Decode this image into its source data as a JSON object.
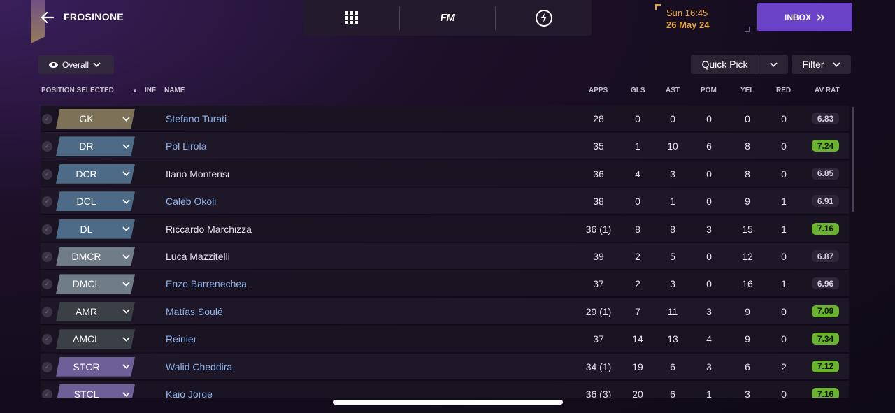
{
  "header": {
    "club_name": "FROSINONE",
    "time": "Sun 16:45",
    "date": "26 May 24",
    "inbox_label": "INBOX",
    "fm_label": "FM"
  },
  "toolbar": {
    "view_label": "Overall",
    "quick_pick_label": "Quick Pick",
    "filter_label": "Filter"
  },
  "columns": {
    "position": "POSITION SELECTED",
    "inf": "INF",
    "name": "NAME",
    "apps": "APPS",
    "gls": "GLS",
    "ast": "AST",
    "pom": "POM",
    "yel": "YEL",
    "red": "RED",
    "av_rat": "AV RAT"
  },
  "colors": {
    "gk": "#7d7257",
    "def": "#4d6b86",
    "dm": "#717c89",
    "am": "#3a4046",
    "st": "#6d5f97",
    "rating_good": "#6ab32e",
    "inbox": "#6b43c9"
  },
  "rows": [
    {
      "pos": "GK",
      "group": "gk",
      "name": "Stefano Turati",
      "link": true,
      "apps": "28",
      "gls": "0",
      "ast": "0",
      "pom": "0",
      "yel": "0",
      "red": "0",
      "rat": "6.83",
      "good": false
    },
    {
      "pos": "DR",
      "group": "def",
      "name": "Pol Lirola",
      "link": true,
      "apps": "35",
      "gls": "1",
      "ast": "10",
      "pom": "6",
      "yel": "8",
      "red": "0",
      "rat": "7.24",
      "good": true
    },
    {
      "pos": "DCR",
      "group": "def",
      "name": "Ilario Monterisi",
      "link": false,
      "apps": "36",
      "gls": "4",
      "ast": "3",
      "pom": "0",
      "yel": "8",
      "red": "0",
      "rat": "6.85",
      "good": false
    },
    {
      "pos": "DCL",
      "group": "def",
      "name": "Caleb Okoli",
      "link": true,
      "apps": "38",
      "gls": "0",
      "ast": "1",
      "pom": "0",
      "yel": "9",
      "red": "1",
      "rat": "6.91",
      "good": false
    },
    {
      "pos": "DL",
      "group": "def",
      "name": "Riccardo Marchizza",
      "link": false,
      "apps": "36 (1)",
      "gls": "8",
      "ast": "8",
      "pom": "3",
      "yel": "15",
      "red": "1",
      "rat": "7.16",
      "good": true
    },
    {
      "pos": "DMCR",
      "group": "dm",
      "name": "Luca Mazzitelli",
      "link": false,
      "apps": "39",
      "gls": "2",
      "ast": "5",
      "pom": "0",
      "yel": "12",
      "red": "0",
      "rat": "6.87",
      "good": false
    },
    {
      "pos": "DMCL",
      "group": "dm",
      "name": "Enzo Barrenechea",
      "link": true,
      "apps": "37",
      "gls": "2",
      "ast": "3",
      "pom": "0",
      "yel": "16",
      "red": "1",
      "rat": "6.96",
      "good": false
    },
    {
      "pos": "AMR",
      "group": "am",
      "name": "Matías Soulé",
      "link": true,
      "apps": "29 (1)",
      "gls": "7",
      "ast": "11",
      "pom": "3",
      "yel": "9",
      "red": "0",
      "rat": "7.09",
      "good": true
    },
    {
      "pos": "AMCL",
      "group": "am",
      "name": "Reinier",
      "link": true,
      "apps": "37",
      "gls": "14",
      "ast": "13",
      "pom": "4",
      "yel": "9",
      "red": "0",
      "rat": "7.34",
      "good": true
    },
    {
      "pos": "STCR",
      "group": "st",
      "name": "Walid Cheddira",
      "link": true,
      "apps": "34 (1)",
      "gls": "19",
      "ast": "6",
      "pom": "3",
      "yel": "6",
      "red": "2",
      "rat": "7.12",
      "good": true
    },
    {
      "pos": "STCL",
      "group": "st",
      "name": "Kaio Jorge",
      "link": true,
      "apps": "36 (3)",
      "gls": "20",
      "ast": "6",
      "pom": "1",
      "yel": "3",
      "red": "0",
      "rat": "7.16",
      "good": true
    }
  ]
}
